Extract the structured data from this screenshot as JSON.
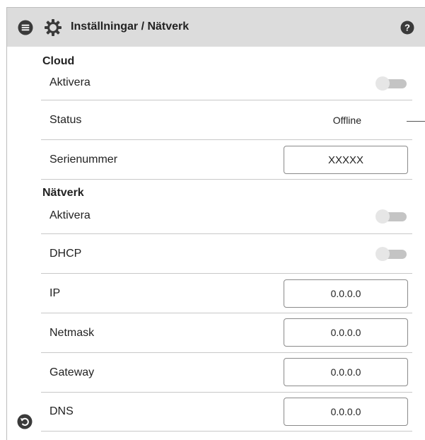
{
  "header": {
    "title": "Inställningar / Nätverk",
    "menu_icon": "menu-icon",
    "settings_icon": "gear-icon",
    "help_icon": "help-icon"
  },
  "cloud": {
    "section_title": "Cloud",
    "enable_label": "Aktivera",
    "enable_value": false,
    "status_label": "Status",
    "status_value": "Offline",
    "serial_label": "Serienummer",
    "serial_value": "XXXXX"
  },
  "network": {
    "section_title": "Nätverk",
    "enable_label": "Aktivera",
    "enable_value": false,
    "dhcp_label": "DHCP",
    "dhcp_value": false,
    "ip_label": "IP",
    "ip_value": "0.0.0.0",
    "netmask_label": "Netmask",
    "netmask_value": "0.0.0.0",
    "gateway_label": "Gateway",
    "gateway_value": "0.0.0.0",
    "dns_label": "DNS",
    "dns_value": "0.0.0.0"
  },
  "footer": {
    "back_icon": "back-icon"
  },
  "colors": {
    "header_bg": "#dcdcdc",
    "icon_dark": "#3a3a3a",
    "toggle_track": "#c4c4c4",
    "toggle_knob": "#e6e6e6"
  }
}
